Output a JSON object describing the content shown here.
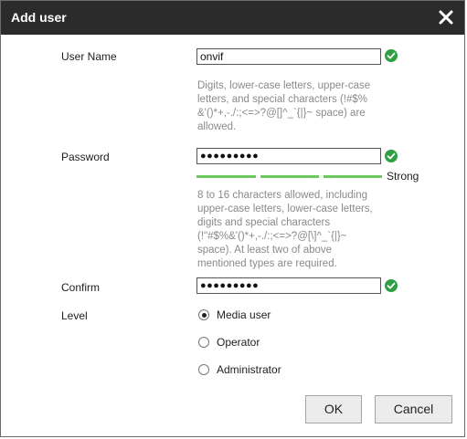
{
  "dialog": {
    "title": "Add user",
    "close_icon": "close-icon"
  },
  "form": {
    "username": {
      "label": "User Name",
      "value": "onvif",
      "valid_icon": "check-circle-icon",
      "hint": "Digits, lower-case letters, upper-case letters, and special characters (!#$% &'()*+,-./:;<=>?@[]^_`{|}~ space) are allowed."
    },
    "password": {
      "label": "Password",
      "value": "●●●●●●●●●",
      "valid_icon": "check-circle-icon",
      "strength_label": "Strong",
      "strength_segments_filled": 3,
      "hint": "8 to 16 characters allowed, including upper-case letters, lower-case letters, digits and special characters (!\"#$%&'()*+,-./:;<=>?@[\\]^_`{|}~ space). At least two of above mentioned types are required."
    },
    "confirm": {
      "label": "Confirm",
      "value": "●●●●●●●●●",
      "valid_icon": "check-circle-icon"
    },
    "level": {
      "label": "Level",
      "options": [
        "Media user",
        "Operator",
        "Administrator"
      ],
      "selected": "Media user"
    }
  },
  "buttons": {
    "ok": "OK",
    "cancel": "Cancel"
  },
  "colors": {
    "titlebar": "#2b2b2b",
    "valid": "#2ea043",
    "strength": "#6bc85c",
    "hint": "#8a8a8a"
  }
}
